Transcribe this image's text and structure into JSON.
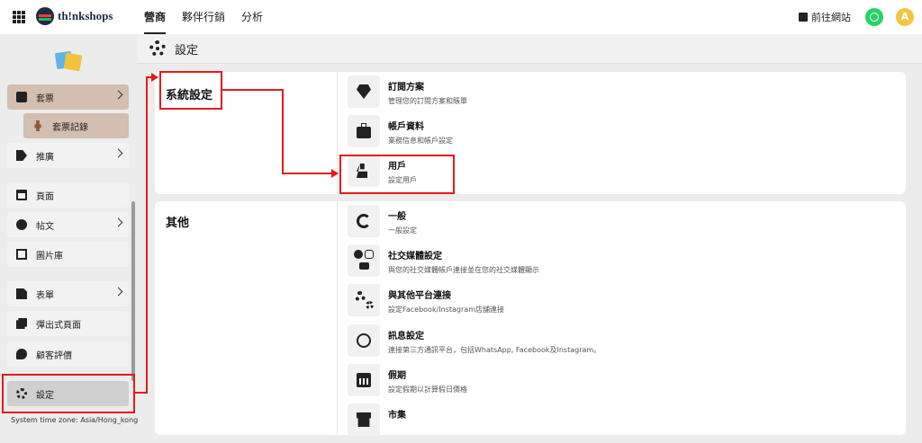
{
  "topbar": {
    "brand": "th!nkshops",
    "nav": [
      "營商",
      "夥伴行銷",
      "分析"
    ],
    "visit_site": "前往網站",
    "avatar_letter": "A"
  },
  "sidebar": {
    "items": [
      {
        "label": "套票"
      },
      {
        "label": "套票記錄"
      },
      {
        "label": "推廣"
      },
      {
        "label": "頁面"
      },
      {
        "label": "帖文"
      },
      {
        "label": "圖片庫"
      },
      {
        "label": "表單"
      },
      {
        "label": "彈出式頁面"
      },
      {
        "label": "顧客評價"
      },
      {
        "label": "設定"
      }
    ],
    "timezone": "System time zone: Asia/Hong_kong"
  },
  "page": {
    "title": "設定"
  },
  "system_settings": {
    "title": "系統設定",
    "rows": [
      {
        "title": "訂閱方案",
        "desc": "管理您的訂閱方案和賬單"
      },
      {
        "title": "帳戶資料",
        "desc": "業務信息和帳戶設定"
      },
      {
        "title": "用戶",
        "desc": "設定用戶"
      }
    ]
  },
  "other": {
    "title": "其他",
    "rows": [
      {
        "title": "一般",
        "desc": "一般設定"
      },
      {
        "title": "社交媒體設定",
        "desc": "與您的社交媒體帳戶連接並在您的社交媒體顯示"
      },
      {
        "title": "與其他平台連接",
        "desc": "設定Facebook/Instagram店舖連接"
      },
      {
        "title": "訊息設定",
        "desc": "連接第三方通訊平台，包括WhatsApp, Facebook及Instagram。"
      },
      {
        "title": "假期",
        "desc": "設定假期以計算假日價格"
      },
      {
        "title": "市集",
        "desc": ""
      }
    ]
  },
  "colors": {
    "annotation": "#e21b1b",
    "sidebar_highlight": "#d3beaf",
    "whatsapp": "#25d366",
    "avatar": "#f4c542"
  }
}
